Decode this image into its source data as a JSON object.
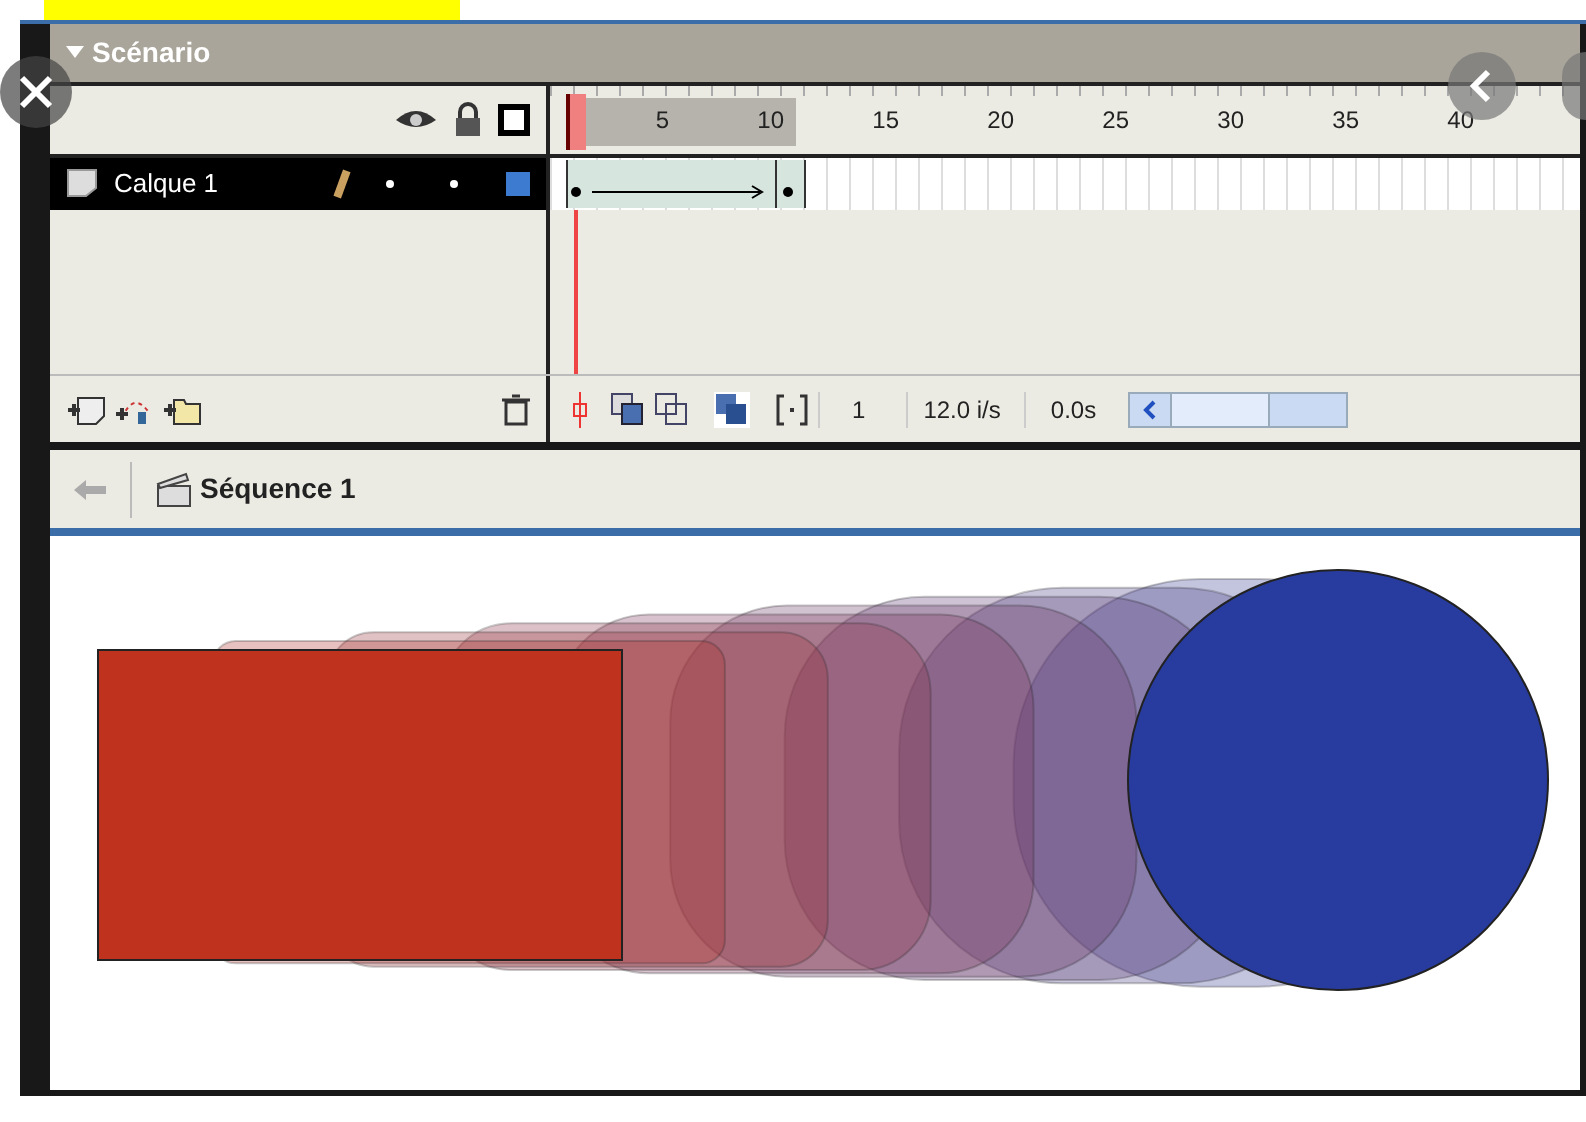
{
  "panel": {
    "title": "Scénario"
  },
  "ruler": {
    "ticks": [
      "5",
      "10",
      "15",
      "20",
      "25",
      "30",
      "35",
      "40"
    ]
  },
  "layers": [
    {
      "name": "Calque 1",
      "selected": true
    }
  ],
  "toolbar": {
    "frame": "1",
    "rate": "12.0 i/s",
    "time": "0.0s"
  },
  "scene": {
    "name": "Séquence 1"
  }
}
